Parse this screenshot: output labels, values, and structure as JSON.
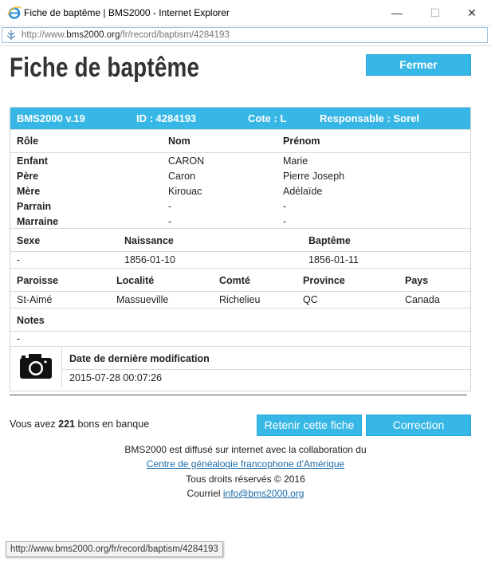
{
  "window": {
    "title": "Fiche de baptême | BMS2000 - Internet Explorer",
    "url_prefix": "http://www.",
    "url_domain": "bms2000.org",
    "url_path": "/fr/record/baptism/4284193",
    "minimize": "—",
    "maximize": "☐",
    "close": "✕"
  },
  "page": {
    "title": "Fiche de baptême",
    "close_button": "Fermer"
  },
  "card": {
    "header": {
      "app": "BMS2000 v.19",
      "id": "ID : 4284193",
      "cote": "Cote : L",
      "responsable": "Responsable : Sorel"
    },
    "persons": {
      "headers": [
        "Rôle",
        "Nom",
        "Prénom"
      ],
      "rows": [
        {
          "role": "Enfant",
          "nom": "CARON",
          "prenom": "Marie"
        },
        {
          "role": "Père",
          "nom": "Caron",
          "prenom": "Pierre Joseph"
        },
        {
          "role": "Mère",
          "nom": "Kirouac",
          "prenom": "Adélaïde"
        },
        {
          "role": "Parrain",
          "nom": "-",
          "prenom": "-"
        },
        {
          "role": "Marraine",
          "nom": "-",
          "prenom": "-"
        }
      ]
    },
    "dates": {
      "headers": [
        "Sexe",
        "Naissance",
        "Baptême"
      ],
      "values": [
        "-",
        "1856-01-10",
        "1856-01-11"
      ]
    },
    "place": {
      "headers": [
        "Paroisse",
        "Localité",
        "Comté",
        "Province",
        "Pays"
      ],
      "values": [
        "St-Aimé",
        "Massueville",
        "Richelieu",
        "QC",
        "Canada"
      ]
    },
    "notes": {
      "header": "Notes",
      "value": "-"
    },
    "modified": {
      "icon": "camera-icon",
      "header": "Date de dernière modification",
      "value": "2015-07-28 00:07:26"
    }
  },
  "bank": {
    "prefix": "Vous avez ",
    "count": "221",
    "suffix": " bons en banque"
  },
  "actions": {
    "retain": "Retenir cette fiche",
    "correction": "Correction"
  },
  "footer": {
    "line1": "BMS2000 est diffusé sur internet avec la collaboration du",
    "link": "Centre de généalogie francophone d'Amérique",
    "line3": "Tous droits réservés © 2016",
    "mail_prefix": "Courriel ",
    "mail": "info@bms2000.org"
  },
  "status": {
    "url": "http://www.bms2000.org/fr/record/baptism/4284193"
  },
  "colors": {
    "accent": "#37b7e6",
    "link": "#1a6aa8"
  }
}
